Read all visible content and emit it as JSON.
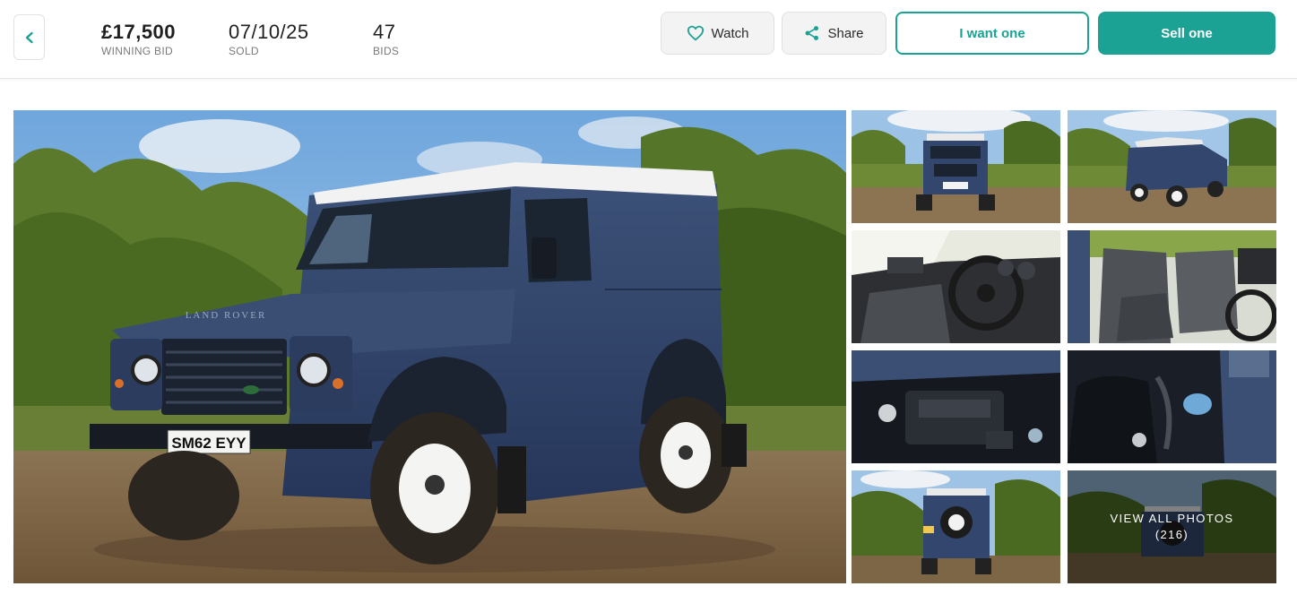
{
  "header": {
    "winning_bid": {
      "value": "£17,500",
      "label": "WINNING BID"
    },
    "sold": {
      "value": "07/10/25",
      "label": "SOLD"
    },
    "bids": {
      "value": "47",
      "label": "BIDS"
    },
    "buttons": {
      "watch": "Watch",
      "share": "Share",
      "want": "I want one",
      "sell": "Sell one"
    }
  },
  "gallery": {
    "main_photo": {
      "plate": "SM62 EYY",
      "badge": "LAND ROVER"
    },
    "view_all": {
      "label": "VIEW ALL PHOTOS",
      "count": "(216)"
    }
  },
  "colors": {
    "accent": "#1ba294",
    "vehicle_body": "#2f4266",
    "vehicle_roof": "#f2f2f2",
    "sky": "#7fb1df",
    "foliage": "#5d7a2f",
    "ground": "#8a6d4a"
  },
  "icons": {
    "back": "chevron-left-icon",
    "watch": "heart-icon",
    "share": "share-icon"
  }
}
